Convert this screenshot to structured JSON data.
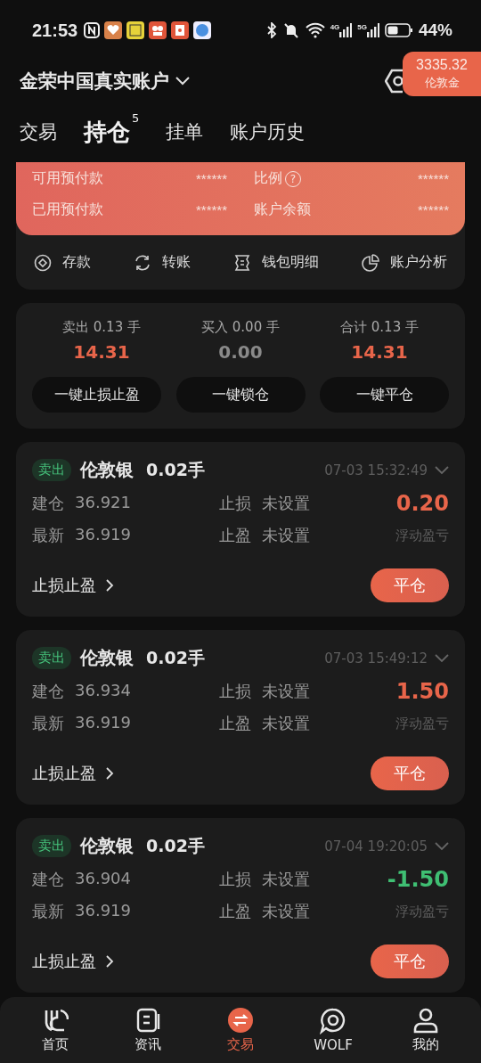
{
  "status_bar": {
    "time": "21:53",
    "network_4g": "4G",
    "network_5g": "5G",
    "battery": "44%"
  },
  "header": {
    "account": "金荣中国真实账户",
    "price_badge": {
      "value": "3335.32",
      "label": "伦敦金"
    }
  },
  "tabs": [
    {
      "label": "交易",
      "selected": false
    },
    {
      "label": "持仓",
      "selected": true,
      "count": "5"
    },
    {
      "label": "挂单",
      "selected": false
    },
    {
      "label": "账户历史",
      "selected": false
    }
  ],
  "funds": [
    {
      "label": "可用预付款",
      "value": "******"
    },
    {
      "label": "比例",
      "help": "?",
      "value": "******"
    },
    {
      "label": "已用预付款",
      "value": "******"
    },
    {
      "label": "账户余额",
      "value": "******"
    }
  ],
  "actions": [
    {
      "kind": "deposit",
      "label": "存款"
    },
    {
      "kind": "transfer",
      "label": "转账"
    },
    {
      "kind": "wallet",
      "label": "钱包明细"
    },
    {
      "kind": "analysis",
      "label": "账户分析"
    }
  ],
  "summary": {
    "columns": [
      {
        "label": "卖出 0.13 手",
        "value": "14.31",
        "color": "#e8654a"
      },
      {
        "label": "买入 0.00 手",
        "value": "0.00",
        "color": "#8a8a8a"
      },
      {
        "label": "合计 0.13 手",
        "value": "14.31",
        "color": "#e8654a"
      }
    ],
    "buttons": [
      "一键止损止盈",
      "一键锁仓",
      "一键平仓"
    ]
  },
  "positions": [
    {
      "side": "卖出",
      "symbol": "伦敦银",
      "lots": "0.02手",
      "time": "07-03 15:32:49",
      "open_label": "建仓",
      "open": "36.921",
      "latest_label": "最新",
      "latest": "36.919",
      "sl_label": "止损",
      "sl": "未设置",
      "tp_label": "止盈",
      "tp": "未设置",
      "pnl": "0.20",
      "color": "#e8654a",
      "pnl_label": "浮动盈亏",
      "link": "止损止盈",
      "close": "平仓"
    },
    {
      "side": "卖出",
      "symbol": "伦敦银",
      "lots": "0.02手",
      "time": "07-03 15:49:12",
      "open_label": "建仓",
      "open": "36.934",
      "latest_label": "最新",
      "latest": "36.919",
      "sl_label": "止损",
      "sl": "未设置",
      "tp_label": "止盈",
      "tp": "未设置",
      "pnl": "1.50",
      "color": "#e8654a",
      "pnl_label": "浮动盈亏",
      "link": "止损止盈",
      "close": "平仓"
    },
    {
      "side": "卖出",
      "symbol": "伦敦银",
      "lots": "0.02手",
      "time": "07-04 19:20:05",
      "open_label": "建仓",
      "open": "36.904",
      "latest_label": "最新",
      "latest": "36.919",
      "sl_label": "止损",
      "sl": "未设置",
      "tp_label": "止盈",
      "tp": "未设置",
      "pnl": "-1.50",
      "color": "#3fbf73",
      "pnl_label": "浮动盈亏",
      "link": "止损止盈",
      "close": "平仓"
    }
  ],
  "nav": [
    {
      "kind": "home",
      "label": "首页",
      "selected": false
    },
    {
      "kind": "news",
      "label": "资讯",
      "selected": false
    },
    {
      "kind": "trade",
      "label": "交易",
      "selected": true
    },
    {
      "kind": "wolf",
      "label": "WOLF",
      "selected": false
    },
    {
      "kind": "me",
      "label": "我的",
      "selected": false
    }
  ]
}
